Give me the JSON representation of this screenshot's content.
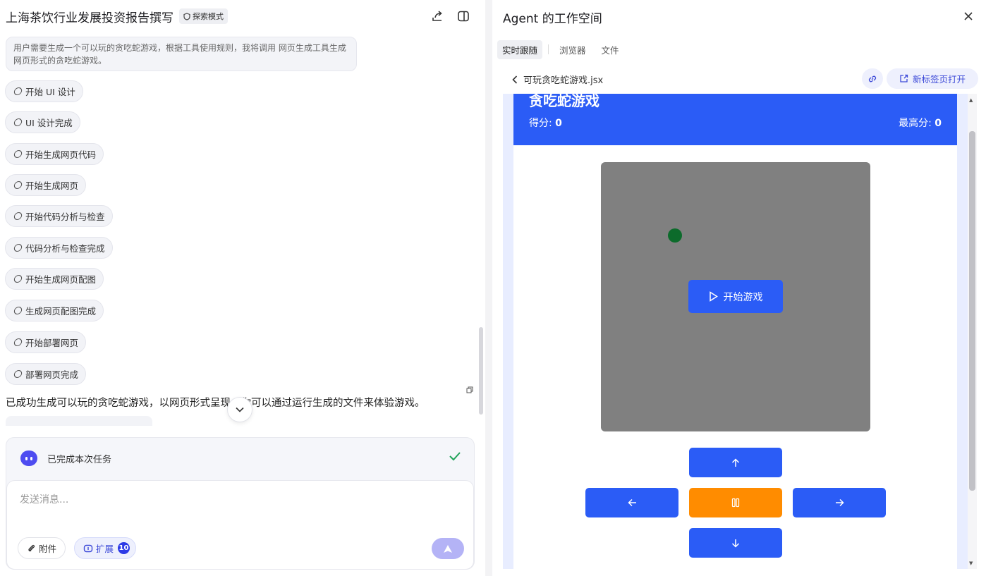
{
  "left": {
    "title": "上海茶饮行业发展投资报告撰写",
    "mode_badge": "探索模式",
    "thought": "用户需要生成一个可以玩的贪吃蛇游戏，根据工具使用规则，我将调用 网页生成工具生成网页形式的贪吃蛇游戏。",
    "steps": [
      "开始 UI 设计",
      "UI 设计完成",
      "开始生成网页代码",
      "开始生成网页",
      "开始代码分析与检查",
      "代码分析与检查完成",
      "开始生成网页配图",
      "生成网页配图完成",
      "开始部署网页",
      "部署网页完成"
    ],
    "result_text": "已成功生成可以玩的贪吃蛇游戏，以网页形式呈现，你可以通过运行生成的文件来体验游戏。",
    "task_status": "已完成本次任务",
    "composer": {
      "placeholder": "发送消息...",
      "attach_label": "附件",
      "expand_label": "扩展",
      "expand_count": "10"
    }
  },
  "right": {
    "title": "Agent 的工作空间",
    "tabs": [
      "实时跟随",
      "浏览器",
      "文件"
    ],
    "active_tab": "实时跟随",
    "file_name": "可玩贪吃蛇游戏.jsx",
    "open_new_tab_label": "新标签页打开",
    "game": {
      "title": "贪吃蛇游戏",
      "score_label": "得分:",
      "score_value": "0",
      "high_score_label": "最高分:",
      "high_score_value": "0",
      "start_label": "开始游戏"
    }
  },
  "colors": {
    "accent": "#2b5cf6",
    "pause": "#ff8c00",
    "board": "#808080",
    "food": "#0c6b2b",
    "success": "#22a35a"
  },
  "icons": {
    "share": "share-icon",
    "panel_toggle": "panel-toggle-icon",
    "close": "close-icon",
    "back": "chevron-left-icon",
    "link": "link-icon",
    "open_tab": "external-link-icon",
    "attach": "paperclip-icon",
    "expand": "extension-icon",
    "send": "send-icon",
    "check": "check-icon"
  }
}
